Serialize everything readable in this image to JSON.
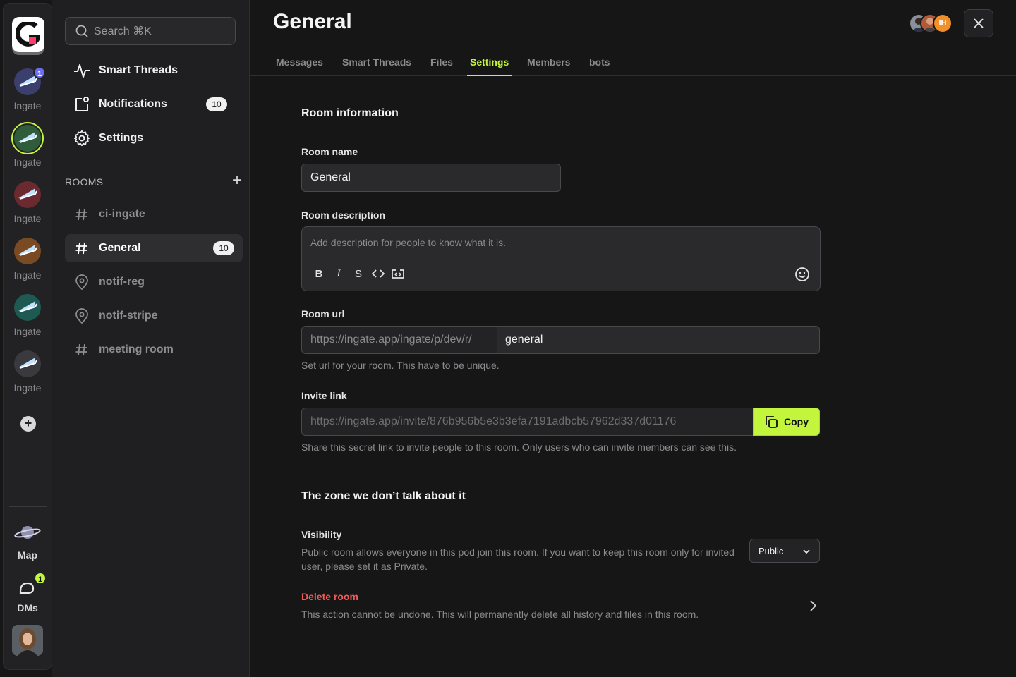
{
  "rail": {
    "pods": [
      {
        "label": "Ingate",
        "badge": "1"
      },
      {
        "label": "Ingate"
      },
      {
        "label": "Ingate"
      },
      {
        "label": "Ingate"
      },
      {
        "label": "Ingate"
      },
      {
        "label": "Ingate"
      }
    ],
    "map_label": "Map",
    "dms_label": "DMs",
    "dms_badge": "1"
  },
  "sidebar": {
    "search_placeholder": "Search ⌘K",
    "nav": [
      {
        "label": "Smart Threads"
      },
      {
        "label": "Notifications",
        "count": "10"
      },
      {
        "label": "Settings"
      }
    ],
    "rooms_title": "ROOMS",
    "rooms": [
      {
        "label": "ci-ingate",
        "icon": "hash-icon"
      },
      {
        "label": "General",
        "icon": "hash-icon",
        "count": "10",
        "active": true
      },
      {
        "label": "notif-reg",
        "icon": "pin-icon"
      },
      {
        "label": "notif-stripe",
        "icon": "pin-icon"
      },
      {
        "label": "meeting room",
        "icon": "hash-icon"
      }
    ]
  },
  "header": {
    "title": "General",
    "member_initials": "IH",
    "tabs": [
      "Messages",
      "Smart Threads",
      "Files",
      "Settings",
      "Members",
      "bots"
    ],
    "active_tab": "Settings"
  },
  "settings": {
    "room_info_title": "Room information",
    "room_name_label": "Room name",
    "room_name_value": "General",
    "room_desc_label": "Room description",
    "room_desc_placeholder": "Add description for people to know what it is.",
    "room_url_label": "Room url",
    "room_url_prefix": "https://ingate.app/ingate/p/dev/r/",
    "room_url_slug": "general",
    "room_url_hint": "Set url for your room. This have to be unique.",
    "invite_label": "Invite link",
    "invite_value": "https://ingate.app/invite/876b956b5e3b3efa7191adbcb57962d337d01176",
    "copy_label": "Copy",
    "invite_hint": "Share this secret link to invite people to this room. Only users who can invite members can see this.",
    "zone_title": "The zone we don’t talk about it",
    "visibility_label": "Visibility",
    "visibility_hint": "Public room allows everyone in this pod join this room. If you want to keep this room only for invited user, please set it as Private.",
    "visibility_value": "Public",
    "delete_title": "Delete room",
    "delete_hint": "This action cannot be undone. This will permanently delete all history and files in this room."
  },
  "colors": {
    "accent": "#c3f53c",
    "danger": "#ef5a5a",
    "background": "#161616"
  }
}
